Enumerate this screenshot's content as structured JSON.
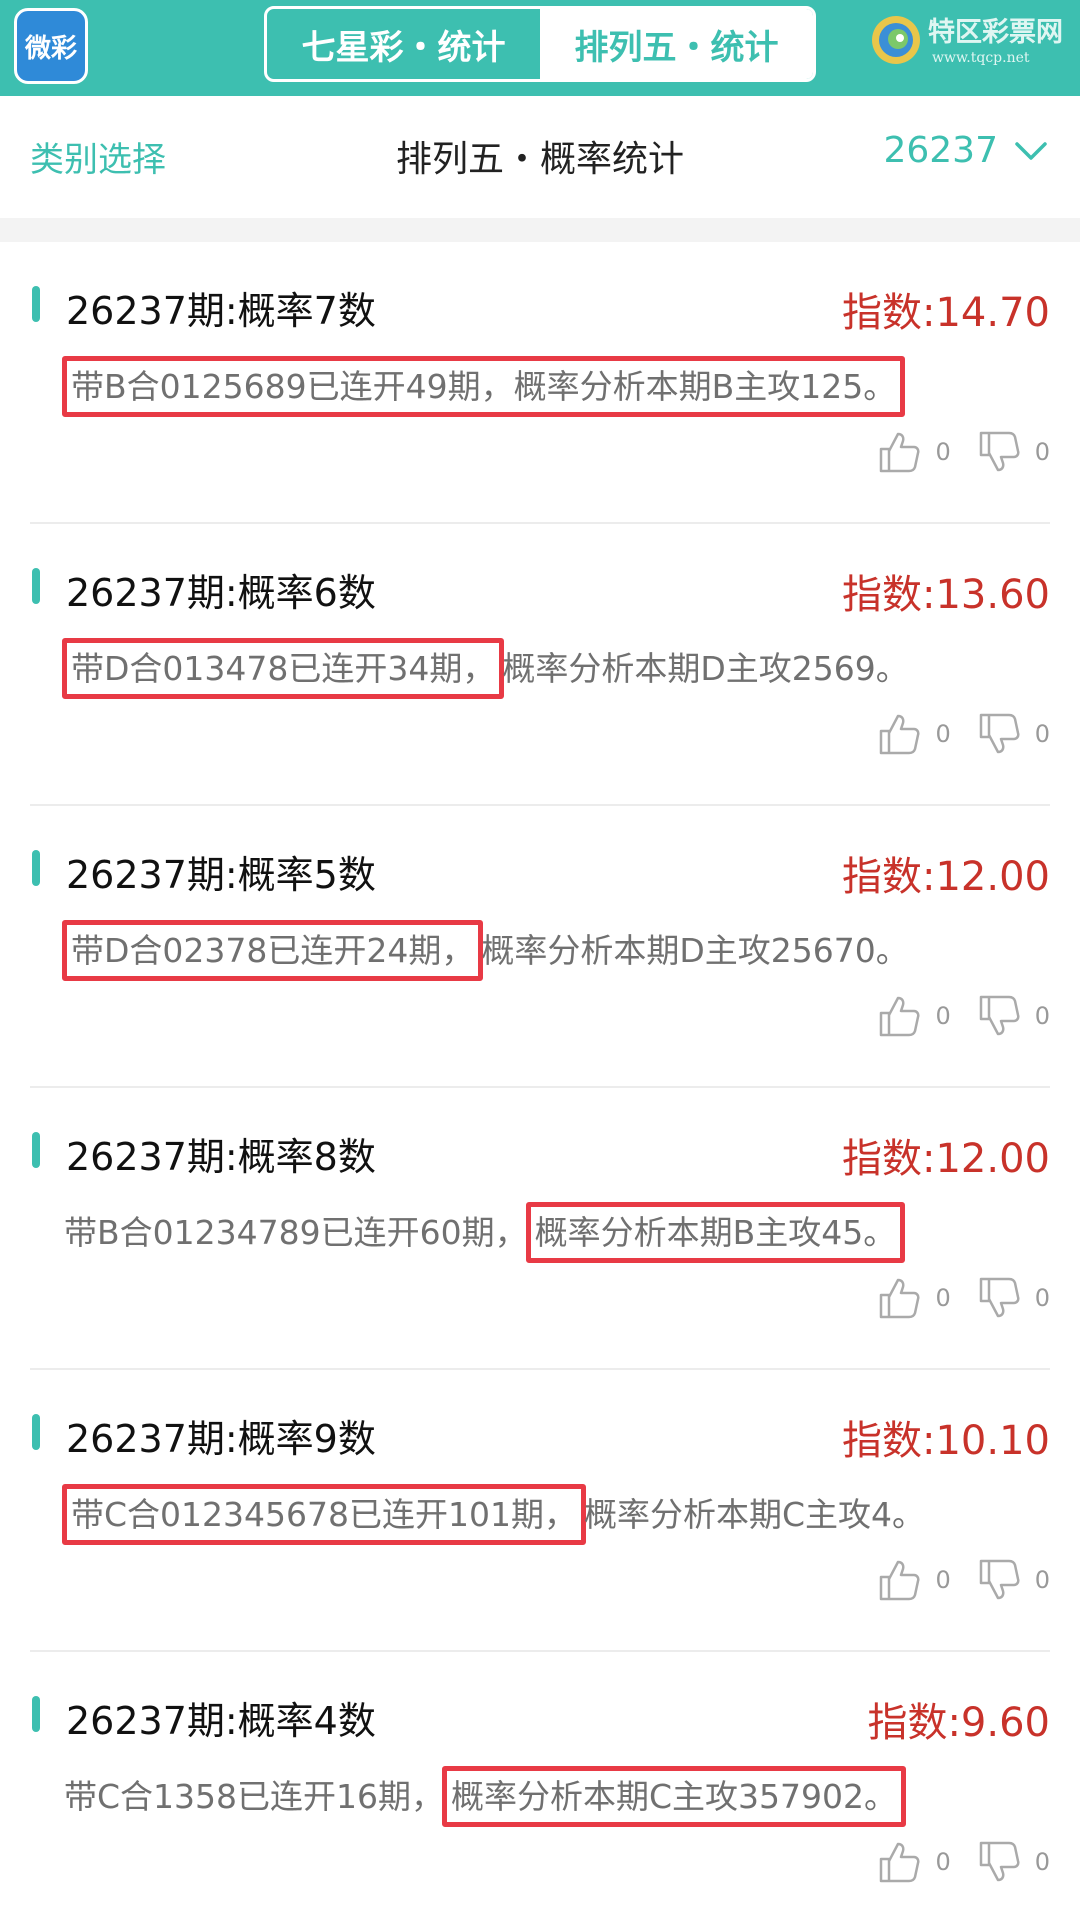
{
  "topbar": {
    "logo_text": "微彩",
    "tabs": [
      {
        "label": "七星彩・统计",
        "active": false
      },
      {
        "label": "排列五・统计",
        "active": true
      }
    ],
    "brand_name": "特区彩票网",
    "brand_url": "www.tqcp.net"
  },
  "header": {
    "category_label": "类别选择",
    "title": "排列五・概率统计",
    "issue": "26237"
  },
  "colors": {
    "accent": "#3dbfb0",
    "index_red": "#c8322a",
    "highlight_border": "#e83a45"
  },
  "cards": [
    {
      "title": "26237期:概率7数",
      "index": "指数:14.70",
      "desc_a": "",
      "desc_hl": "带B合0125689已连开49期，概率分析本期B主攻125。",
      "desc_b": "",
      "likes": "0",
      "dislikes": "0"
    },
    {
      "title": "26237期:概率6数",
      "index": "指数:13.60",
      "desc_a": "",
      "desc_hl": "带D合013478已连开34期，",
      "desc_b": "概率分析本期D主攻2569。",
      "likes": "0",
      "dislikes": "0"
    },
    {
      "title": "26237期:概率5数",
      "index": "指数:12.00",
      "desc_a": "",
      "desc_hl": "带D合02378已连开24期，",
      "desc_b": "概率分析本期D主攻25670。",
      "likes": "0",
      "dislikes": "0"
    },
    {
      "title": "26237期:概率8数",
      "index": "指数:12.00",
      "desc_a": "带B合01234789已连开60期，",
      "desc_hl": "概率分析本期B主攻45。",
      "desc_b": "",
      "likes": "0",
      "dislikes": "0"
    },
    {
      "title": "26237期:概率9数",
      "index": "指数:10.10",
      "desc_a": "",
      "desc_hl": "带C合012345678已连开101期，",
      "desc_b": "概率分析本期C主攻4。",
      "likes": "0",
      "dislikes": "0"
    },
    {
      "title": "26237期:概率4数",
      "index": "指数:9.60",
      "desc_a": "带C合1358已连开16期，",
      "desc_hl": "概率分析本期C主攻357902。",
      "desc_b": "",
      "likes": "0",
      "dislikes": "0"
    }
  ]
}
